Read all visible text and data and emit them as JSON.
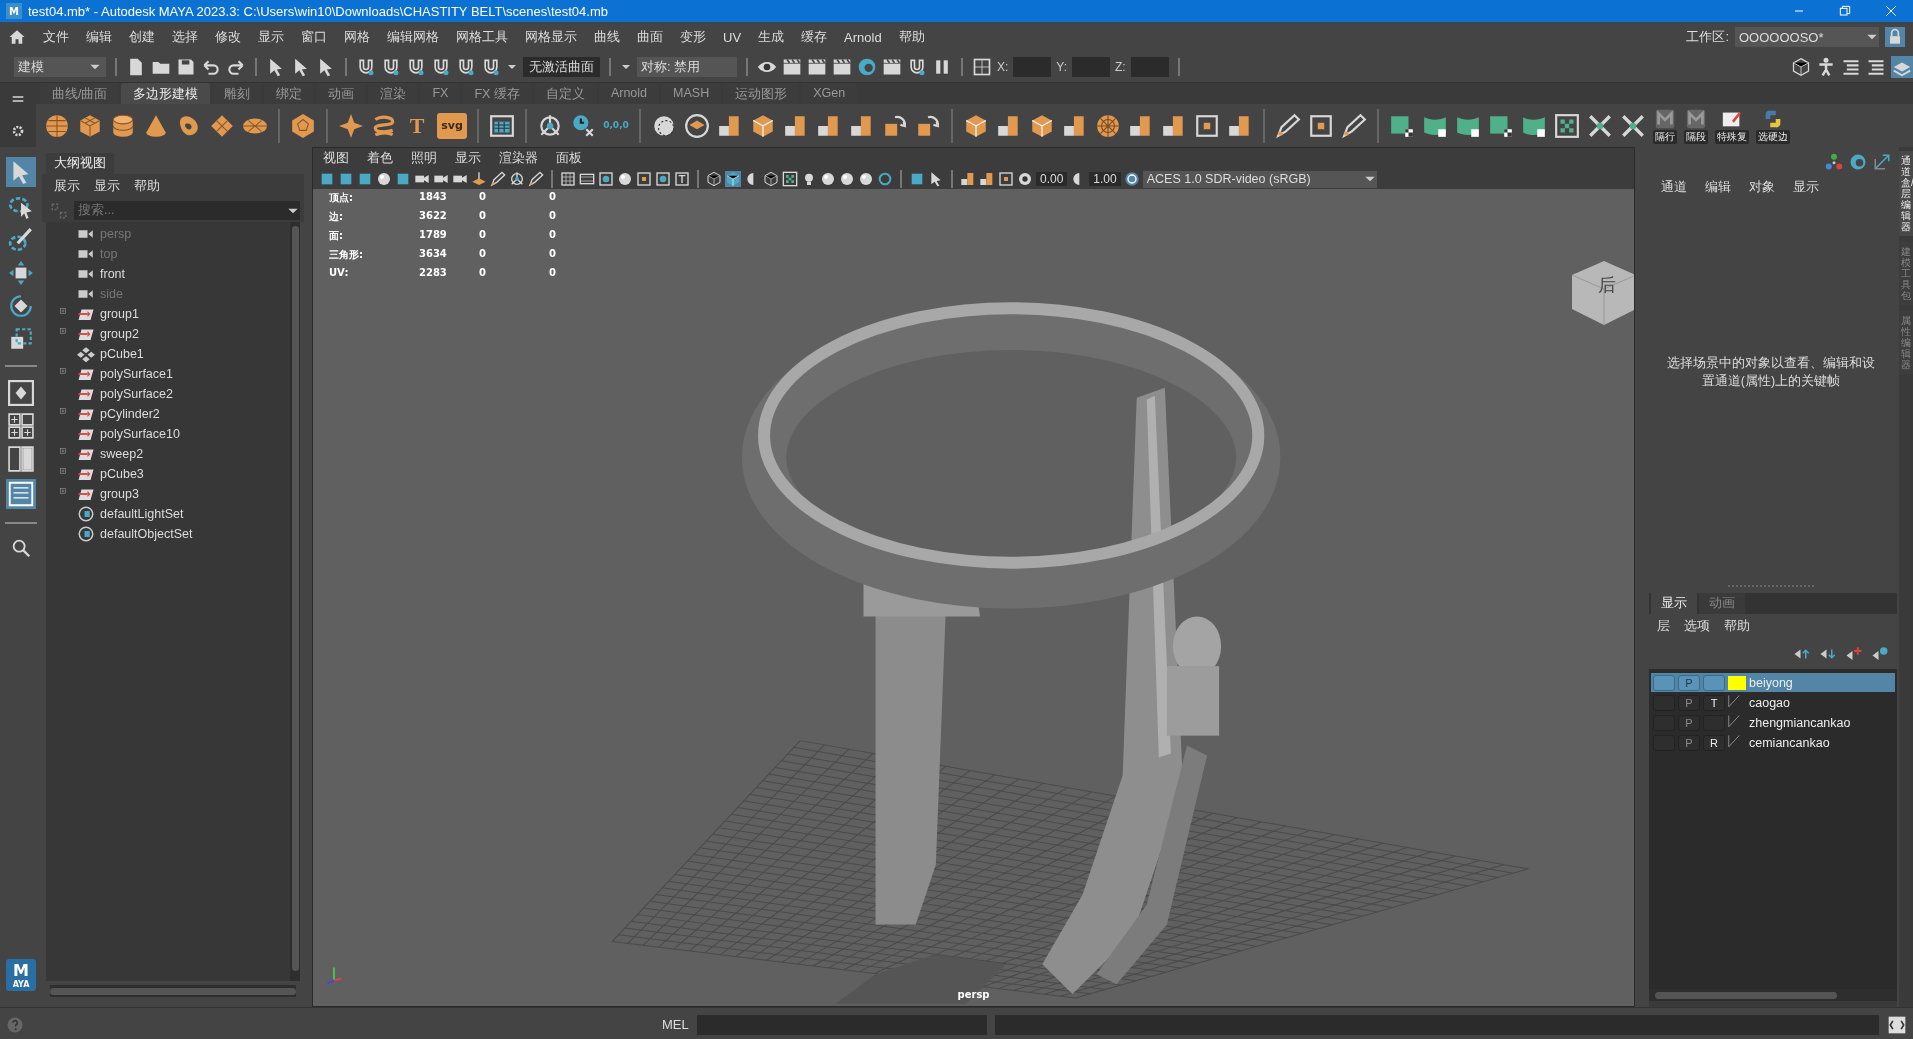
{
  "window": {
    "title": "test04.mb* - Autodesk MAYA 2023.3: C:\\Users\\win10\\Downloads\\CHASTITY BELT\\scenes\\test04.mb",
    "app_mark": "M"
  },
  "menu": [
    "文件",
    "编辑",
    "创建",
    "选择",
    "修改",
    "显示",
    "窗口",
    "网格",
    "编辑网格",
    "网格工具",
    "网格显示",
    "曲线",
    "曲面",
    "变形",
    "UV",
    "生成",
    "缓存",
    "Arnold",
    "帮助"
  ],
  "workspace": {
    "label": "工作区:",
    "value": "OOOOOOSO*"
  },
  "status_line": {
    "mode": "建模",
    "live_surface": "无激活曲面",
    "symmetry": "对称: 禁用",
    "x_label": "X:",
    "y_label": "Y:",
    "z_label": "Z:"
  },
  "shelf": {
    "tabs": [
      {
        "label": "曲线/曲面",
        "selected": false
      },
      {
        "label": "多边形建模",
        "selected": true
      },
      {
        "label": "雕刻",
        "selected": false
      },
      {
        "label": "绑定",
        "selected": false
      },
      {
        "label": "动画",
        "selected": false
      },
      {
        "label": "渲染",
        "selected": false
      },
      {
        "label": "FX",
        "selected": false
      },
      {
        "label": "FX 缓存",
        "selected": false
      },
      {
        "label": "自定义",
        "selected": false
      },
      {
        "label": "Arnold",
        "selected": false
      },
      {
        "label": "MASH",
        "selected": false
      },
      {
        "label": "运动图形",
        "selected": false
      },
      {
        "label": "XGen",
        "selected": false
      }
    ],
    "glyphs": [
      "T",
      "svg",
      "0,0,0"
    ],
    "labels": [
      "隔行",
      "隔段",
      "特殊复",
      "选硬边"
    ]
  },
  "outliner": {
    "title": "大纲视图",
    "menu": [
      "展示",
      "显示",
      "帮助"
    ],
    "search": {
      "placeholder": "搜索..."
    },
    "items": [
      {
        "name": "persp",
        "kind": "camera",
        "dimmed": true,
        "expandable": false
      },
      {
        "name": "top",
        "kind": "camera",
        "dimmed": true,
        "expandable": false
      },
      {
        "name": "front",
        "kind": "camera",
        "dimmed": false,
        "expandable": false
      },
      {
        "name": "side",
        "kind": "camera",
        "dimmed": true,
        "expandable": false
      },
      {
        "name": "group1",
        "kind": "transform",
        "dimmed": false,
        "expandable": true
      },
      {
        "name": "group2",
        "kind": "transform",
        "dimmed": false,
        "expandable": true
      },
      {
        "name": "pCube1",
        "kind": "locator",
        "dimmed": false,
        "expandable": false
      },
      {
        "name": "polySurface1",
        "kind": "transform",
        "dimmed": false,
        "expandable": true
      },
      {
        "name": "polySurface2",
        "kind": "transform",
        "dimmed": false,
        "expandable": false
      },
      {
        "name": "pCylinder2",
        "kind": "transform",
        "dimmed": false,
        "expandable": true
      },
      {
        "name": "polySurface10",
        "kind": "transform",
        "dimmed": false,
        "expandable": false
      },
      {
        "name": "sweep2",
        "kind": "transform",
        "dimmed": false,
        "expandable": true
      },
      {
        "name": "pCube3",
        "kind": "transform",
        "dimmed": false,
        "expandable": true
      },
      {
        "name": "group3",
        "kind": "transform",
        "dimmed": false,
        "expandable": true
      },
      {
        "name": "defaultLightSet",
        "kind": "set",
        "dimmed": false,
        "expandable": false
      },
      {
        "name": "defaultObjectSet",
        "kind": "set",
        "dimmed": false,
        "expandable": false
      }
    ]
  },
  "viewport": {
    "menu": [
      "视图",
      "着色",
      "照明",
      "显示",
      "渲染器",
      "面板"
    ],
    "exposure": "0.00",
    "gamma": "1.00",
    "color_space": "ACES 1.0 SDR-video (sRGB)",
    "hud": [
      {
        "label": "顶点:",
        "values": [
          "1843",
          "0",
          "0"
        ]
      },
      {
        "label": "边:",
        "values": [
          "3622",
          "0",
          "0"
        ]
      },
      {
        "label": "面:",
        "values": [
          "1789",
          "0",
          "0"
        ]
      },
      {
        "label": "三角形:",
        "values": [
          "3634",
          "0",
          "0"
        ]
      },
      {
        "label": "UV:",
        "values": [
          "2283",
          "0",
          "0"
        ]
      }
    ],
    "view_cube_label": "后",
    "camera": "persp"
  },
  "channel_box": {
    "menu": [
      "通道",
      "编辑",
      "对象",
      "显示"
    ],
    "message": "选择场景中的对象以查看、编辑和设置通道(属性)上的关键帧"
  },
  "layer_editor": {
    "tabs": [
      {
        "label": "显示",
        "selected": true
      },
      {
        "label": "动画",
        "selected": false
      }
    ],
    "menu": [
      "层",
      "选项",
      "帮助"
    ],
    "layers": [
      {
        "name": "beiyong",
        "selected": true,
        "playback": "P",
        "color": "#ffff00"
      },
      {
        "name": "caogao",
        "selected": false,
        "playback": "P",
        "mode": "T"
      },
      {
        "name": "zhengmiancankao",
        "selected": false,
        "playback": "P"
      },
      {
        "name": "cemiancankao",
        "selected": false,
        "playback": "P",
        "mode": "R"
      }
    ]
  },
  "side_tabs": [
    {
      "label": "通道盒/层编辑器",
      "selected": true
    },
    {
      "label": "建模工具包",
      "selected": false
    },
    {
      "label": "属性编辑器",
      "selected": false
    }
  ],
  "logo": {
    "mark": "M",
    "caption": "AYA"
  },
  "command_line": {
    "language": "MEL"
  }
}
